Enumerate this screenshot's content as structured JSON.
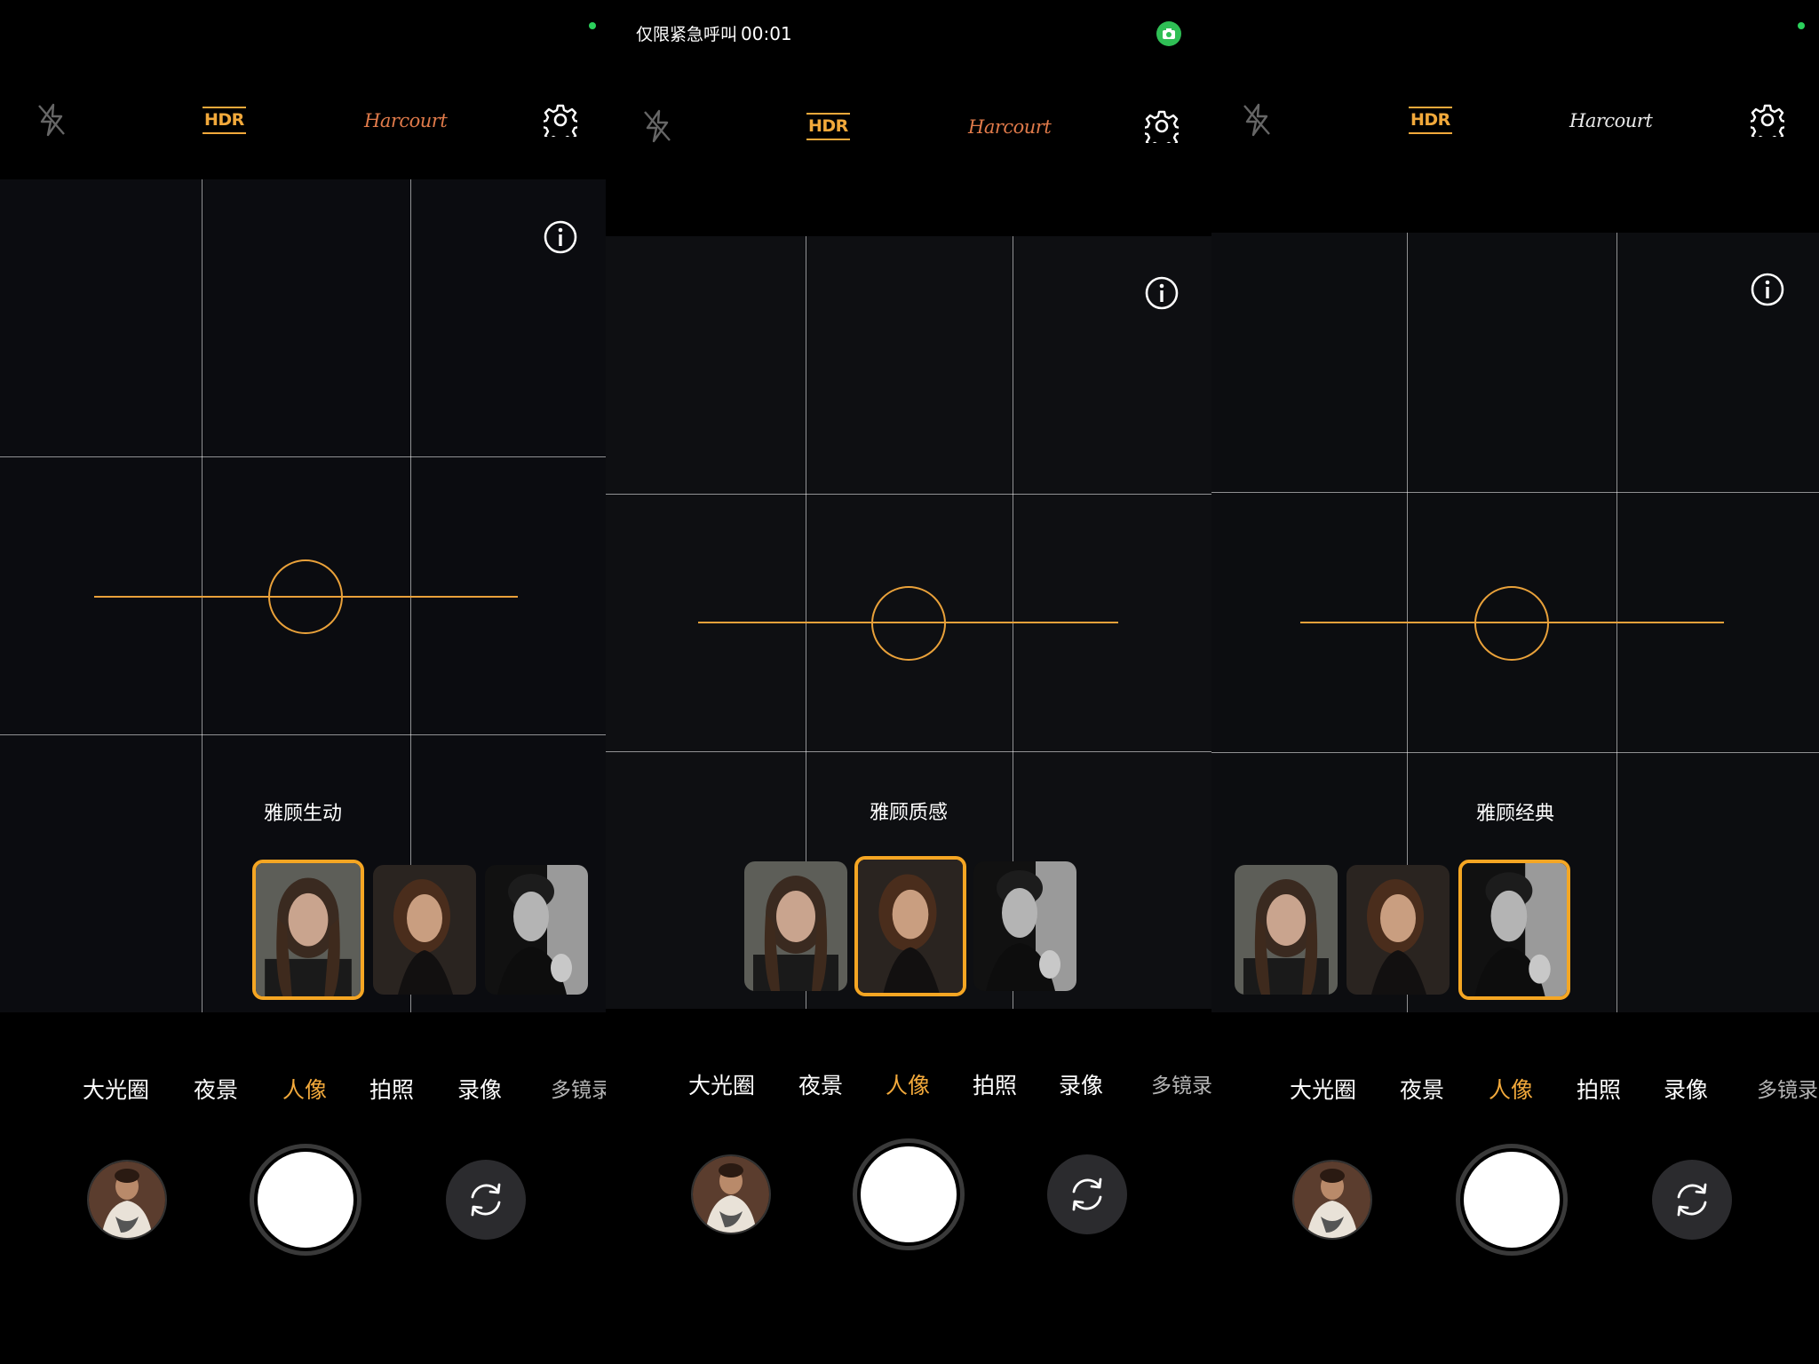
{
  "status": {
    "label": "仅限紧急呼叫",
    "time": "00:01"
  },
  "colors": {
    "accent": "#f2a93b",
    "grid": "#8a8a8a",
    "indicator": "#2fbf55"
  },
  "topbar": {
    "flash_icon": "flash-off-icon",
    "hdr_label": "HDR",
    "brand_label": "Harcourt",
    "settings_icon": "gear-icon"
  },
  "panels": [
    {
      "style_name": "雅顾生动",
      "selected_style": 0
    },
    {
      "style_name": "雅顾质感",
      "selected_style": 1
    },
    {
      "style_name": "雅顾经典",
      "selected_style": 2
    }
  ],
  "modes": [
    "大光圈",
    "夜景",
    "人像",
    "拍照",
    "录像",
    "多镜录"
  ],
  "active_mode": "人像",
  "bottom": {
    "gallery_icon": "gallery-thumbnail",
    "shutter_icon": "shutter-button",
    "flip_icon": "flip-camera-icon"
  }
}
